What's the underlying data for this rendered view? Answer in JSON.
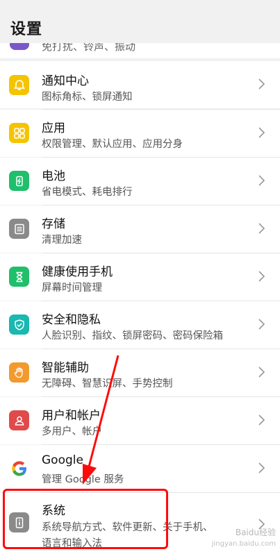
{
  "header": {
    "title": "设置"
  },
  "partial_item": {
    "subtitle": "免打扰、铃声、振动"
  },
  "items": [
    {
      "title": "通知中心",
      "subtitle": "图标角标、锁屏通知"
    },
    {
      "title": "应用",
      "subtitle": "权限管理、默认应用、应用分身"
    },
    {
      "title": "电池",
      "subtitle": "省电模式、耗电排行"
    },
    {
      "title": "存储",
      "subtitle": "清理加速"
    },
    {
      "title": "健康使用手机",
      "subtitle": "屏幕时间管理"
    },
    {
      "title": "安全和隐私",
      "subtitle": "人脸识别、指纹、锁屏密码、密码保险箱"
    },
    {
      "title": "智能辅助",
      "subtitle": "无障碍、智慧识屏、手势控制"
    },
    {
      "title": "用户和帐户",
      "subtitle": "多用户、帐户"
    },
    {
      "title": "Google",
      "subtitle": "管理 Google 服务"
    },
    {
      "title": "系统",
      "subtitle": "系统导航方式、软件更新、关于手机、",
      "subtitle2": "语言和输入法"
    }
  ],
  "watermark": {
    "text": "Baidu经验",
    "url": "jingyan.baidu.com"
  },
  "colors": {
    "accent_highlight": "#ff0a0a",
    "notification_icon": "#f5c400",
    "apps_icon": "#f5c400",
    "battery_icon": "#1fbf6b",
    "storage_icon": "#8a8a8a",
    "health_icon": "#1fbf6b",
    "security_icon": "#19b8b0",
    "assist_icon": "#f29a2e",
    "users_icon": "#e04a4a",
    "system_icon": "#8a8a8a"
  }
}
